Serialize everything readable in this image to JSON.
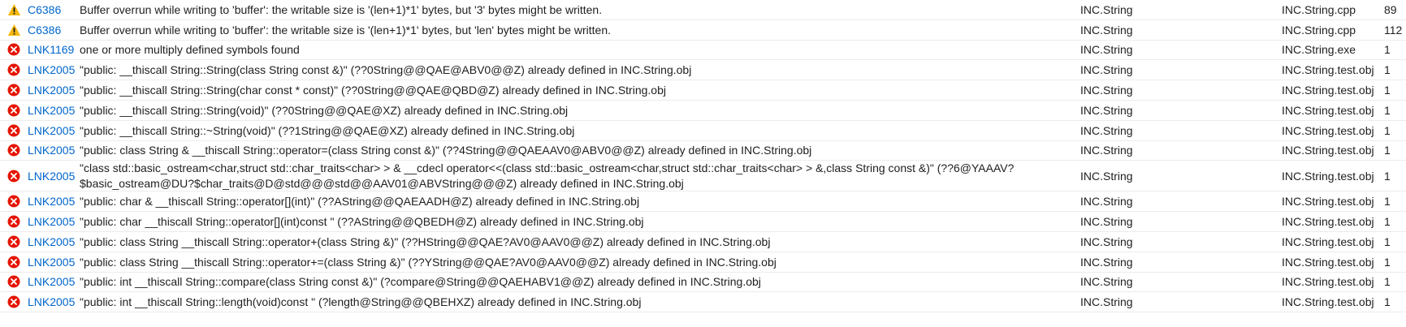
{
  "colors": {
    "error_icon": "#e51400",
    "warning_icon": "#f6b80e",
    "code_link": "#0066cc"
  },
  "rows": [
    {
      "severity": "warning",
      "icon": "warning-icon",
      "code": "C6386",
      "description": "Buffer overrun while writing to 'buffer':  the writable size is '(len+1)*1' bytes, but '3' bytes might be written.",
      "project": "INC.String",
      "file": "INC.String.cpp",
      "line": "89"
    },
    {
      "severity": "warning",
      "icon": "warning-icon",
      "code": "C6386",
      "description": "Buffer overrun while writing to 'buffer':  the writable size is '(len+1)*1' bytes, but 'len' bytes might be written.",
      "project": "INC.String",
      "file": "INC.String.cpp",
      "line": "112"
    },
    {
      "severity": "error",
      "icon": "error-icon",
      "code": "LNK1169",
      "description": "one or more multiply defined symbols found",
      "project": "INC.String",
      "file": "INC.String.exe",
      "line": "1"
    },
    {
      "severity": "error",
      "icon": "error-icon",
      "code": "LNK2005",
      "description": "\"public: __thiscall String::String(class String const &)\" (??0String@@QAE@ABV0@@Z) already defined in INC.String.obj",
      "project": "INC.String",
      "file": "INC.String.test.obj",
      "line": "1"
    },
    {
      "severity": "error",
      "icon": "error-icon",
      "code": "LNK2005",
      "description": "\"public: __thiscall String::String(char const * const)\" (??0String@@QAE@QBD@Z) already defined in INC.String.obj",
      "project": "INC.String",
      "file": "INC.String.test.obj",
      "line": "1"
    },
    {
      "severity": "error",
      "icon": "error-icon",
      "code": "LNK2005",
      "description": "\"public: __thiscall String::String(void)\" (??0String@@QAE@XZ) already defined in INC.String.obj",
      "project": "INC.String",
      "file": "INC.String.test.obj",
      "line": "1"
    },
    {
      "severity": "error",
      "icon": "error-icon",
      "code": "LNK2005",
      "description": "\"public: __thiscall String::~String(void)\" (??1String@@QAE@XZ) already defined in INC.String.obj",
      "project": "INC.String",
      "file": "INC.String.test.obj",
      "line": "1"
    },
    {
      "severity": "error",
      "icon": "error-icon",
      "code": "LNK2005",
      "description": "\"public: class String & __thiscall String::operator=(class String const &)\" (??4String@@QAEAAV0@ABV0@@Z) already defined in INC.String.obj",
      "project": "INC.String",
      "file": "INC.String.test.obj",
      "line": "1"
    },
    {
      "severity": "error",
      "icon": "error-icon",
      "code": "LNK2005",
      "description": "\"class std::basic_ostream<char,struct std::char_traits<char> > & __cdecl operator<<(class std::basic_ostream<char,struct std::char_traits<char> > &,class String const &)\" (??6@YAAAV?$basic_ostream@DU?$char_traits@D@std@@@std@@AAV01@ABVString@@@Z) already defined in INC.String.obj",
      "project": "INC.String",
      "file": "INC.String.test.obj",
      "line": "1"
    },
    {
      "severity": "error",
      "icon": "error-icon",
      "code": "LNK2005",
      "description": "\"public: char & __thiscall String::operator[](int)\" (??AString@@QAEAADH@Z) already defined in INC.String.obj",
      "project": "INC.String",
      "file": "INC.String.test.obj",
      "line": "1"
    },
    {
      "severity": "error",
      "icon": "error-icon",
      "code": "LNK2005",
      "description": "\"public: char __thiscall String::operator[](int)const \" (??AString@@QBEDH@Z) already defined in INC.String.obj",
      "project": "INC.String",
      "file": "INC.String.test.obj",
      "line": "1"
    },
    {
      "severity": "error",
      "icon": "error-icon",
      "code": "LNK2005",
      "description": "\"public: class String __thiscall String::operator+(class String &)\" (??HString@@QAE?AV0@AAV0@@Z) already defined in INC.String.obj",
      "project": "INC.String",
      "file": "INC.String.test.obj",
      "line": "1"
    },
    {
      "severity": "error",
      "icon": "error-icon",
      "code": "LNK2005",
      "description": "\"public: class String __thiscall String::operator+=(class String &)\" (??YString@@QAE?AV0@AAV0@@Z) already defined in INC.String.obj",
      "project": "INC.String",
      "file": "INC.String.test.obj",
      "line": "1"
    },
    {
      "severity": "error",
      "icon": "error-icon",
      "code": "LNK2005",
      "description": "\"public: int __thiscall String::compare(class String const &)\" (?compare@String@@QAEHABV1@@Z) already defined in INC.String.obj",
      "project": "INC.String",
      "file": "INC.String.test.obj",
      "line": "1"
    },
    {
      "severity": "error",
      "icon": "error-icon",
      "code": "LNK2005",
      "description": "\"public: int __thiscall String::length(void)const \" (?length@String@@QBEHXZ) already defined in INC.String.obj",
      "project": "INC.String",
      "file": "INC.String.test.obj",
      "line": "1"
    }
  ]
}
